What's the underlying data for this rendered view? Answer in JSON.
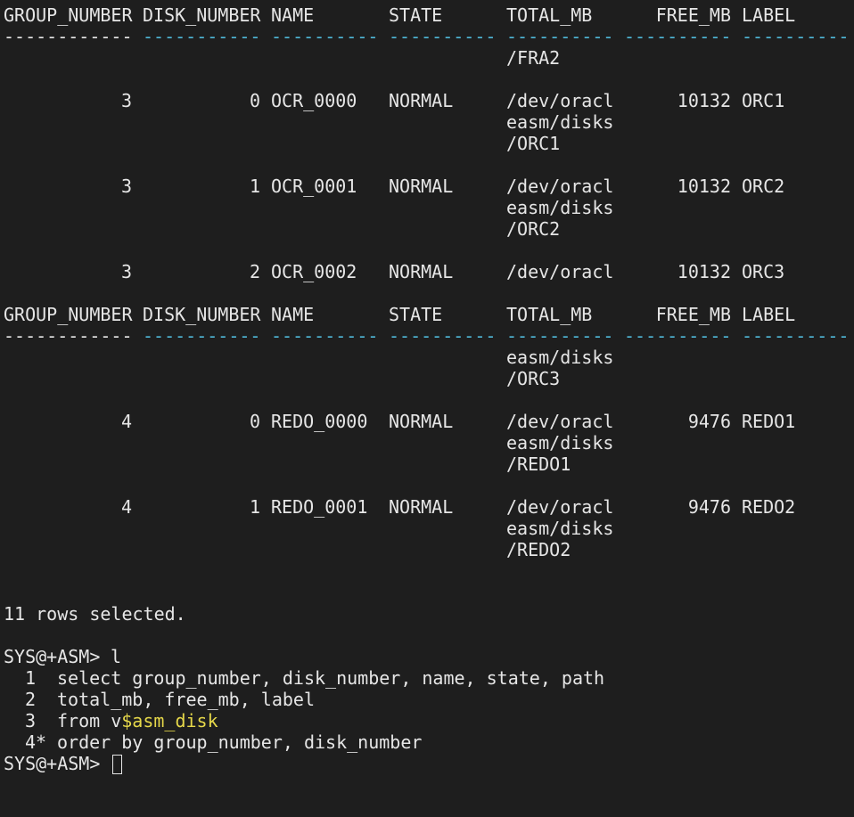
{
  "colors": {
    "background": "#1e1e1e",
    "foreground": "#e6e6e6",
    "separator": "#4fb8d8",
    "highlight": "#e6d84a"
  },
  "headers": {
    "group_number": "GROUP_NUMBER",
    "disk_number": "DISK_NUMBER",
    "name": "NAME",
    "state": "STATE",
    "total_mb": "TOTAL_MB",
    "free_mb": "FREE_MB",
    "label": "LABEL"
  },
  "separators": {
    "group_number": "------------",
    "disk_number": "-----------",
    "name": "----------",
    "state": "----------",
    "total_mb": "----------",
    "free_mb": "----------",
    "label": "----------"
  },
  "fragment1": "/FRA2",
  "rows": [
    {
      "group_number": "3",
      "disk_number": "0",
      "name": "OCR_0000",
      "state": "NORMAL",
      "total_mb": [
        "/dev/oracl",
        "easm/disks",
        "/ORC1"
      ],
      "free_mb": "10132",
      "label": "ORC1"
    },
    {
      "group_number": "3",
      "disk_number": "1",
      "name": "OCR_0001",
      "state": "NORMAL",
      "total_mb": [
        "/dev/oracl",
        "easm/disks",
        "/ORC2"
      ],
      "free_mb": "10132",
      "label": "ORC2"
    },
    {
      "group_number": "3",
      "disk_number": "2",
      "name": "OCR_0002",
      "state": "NORMAL",
      "total_mb": [
        "/dev/oracl"
      ],
      "free_mb": "10132",
      "label": "ORC3"
    },
    {
      "group_number": "4",
      "disk_number": "0",
      "name": "REDO_0000",
      "state": "NORMAL",
      "total_mb": [
        "/dev/oracl",
        "easm/disks",
        "/REDO1"
      ],
      "free_mb": "9476",
      "label": "REDO1"
    },
    {
      "group_number": "4",
      "disk_number": "1",
      "name": "REDO_0001",
      "state": "NORMAL",
      "total_mb": [
        "/dev/oracl",
        "easm/disks",
        "/REDO2"
      ],
      "free_mb": "9476",
      "label": "REDO2"
    }
  ],
  "fragment2": [
    "easm/disks",
    "/ORC3"
  ],
  "rows_selected": "11 rows selected.",
  "prompt": "SYS@+ASM>",
  "command": "l",
  "sql_lines": [
    {
      "num": "1",
      "text": "select group_number, disk_number, name, state, path"
    },
    {
      "num": "2",
      "text": "total_mb, free_mb, label"
    },
    {
      "num": "3",
      "text_pre": "from v",
      "text_hl": "$asm_disk"
    },
    {
      "num": "4*",
      "text": "order by group_number, disk_number"
    }
  ]
}
